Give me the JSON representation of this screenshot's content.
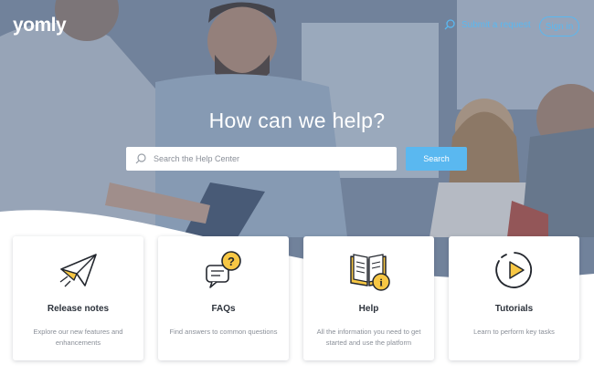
{
  "header": {
    "logo_text": "yomly",
    "request_link": "Submit a request",
    "signin_label": "Sign in"
  },
  "hero": {
    "headline": "How can we help?",
    "search_placeholder": "Search the Help Center",
    "search_button": "Search"
  },
  "cards": [
    {
      "title": "Release notes",
      "description": "Explore our new features and enhancements",
      "icon": "paper-plane-icon"
    },
    {
      "title": "FAQs",
      "description": "Find answers to common questions",
      "icon": "chat-question-icon"
    },
    {
      "title": "Help",
      "description": "All the information you need to get started and use the platform",
      "icon": "book-info-icon"
    },
    {
      "title": "Tutorials",
      "description": "Learn to perform key tasks",
      "icon": "play-button-icon"
    }
  ],
  "colors": {
    "accent": "#5ab8f0",
    "icon_yellow": "#f7c744",
    "text_dark": "#2c323b",
    "text_muted": "#8a8f98"
  }
}
